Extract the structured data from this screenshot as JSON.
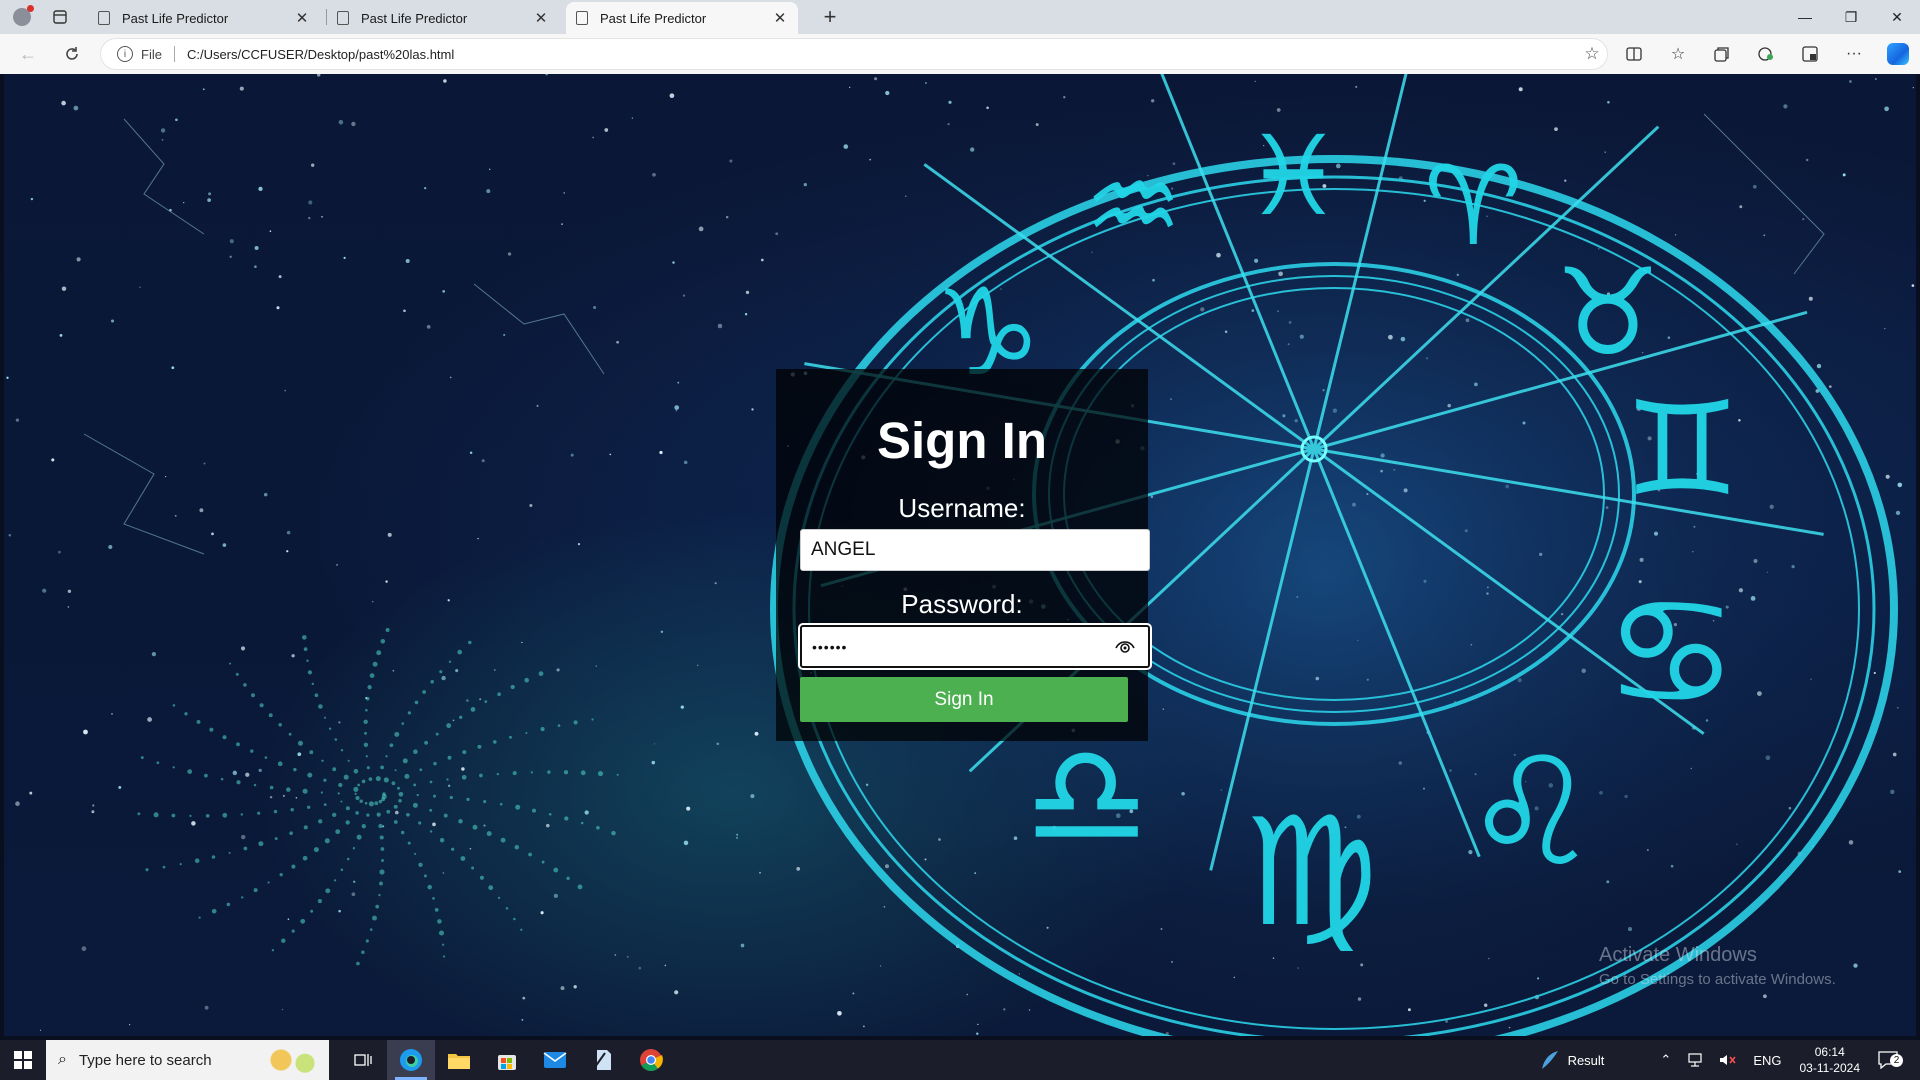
{
  "browser": {
    "tabs": [
      {
        "title": "Past Life Predictor",
        "active": false
      },
      {
        "title": "Past Life Predictor",
        "active": false
      },
      {
        "title": "Past Life Predictor",
        "active": true
      }
    ],
    "address": {
      "scheme_label": "File",
      "url": "C:/Users/CCFUSER/Desktop/past%20las.html"
    }
  },
  "login": {
    "title": "Sign In",
    "username_label": "Username:",
    "username_value": "ANGEL",
    "password_label": "Password:",
    "password_mask": "••••••",
    "submit_label": "Sign In"
  },
  "watermark": {
    "line1": "Activate Windows",
    "line2": "Go to Settings to activate Windows."
  },
  "taskbar": {
    "search_placeholder": "Type here to search",
    "weather_label": "Result",
    "language": "ENG",
    "time": "06:14",
    "date": "03-11-2024",
    "notification_count": "2"
  },
  "colors": {
    "accent_green": "#4caf50",
    "zodiac_cyan": "#27d3e6",
    "sky_navy": "#0b1736"
  }
}
